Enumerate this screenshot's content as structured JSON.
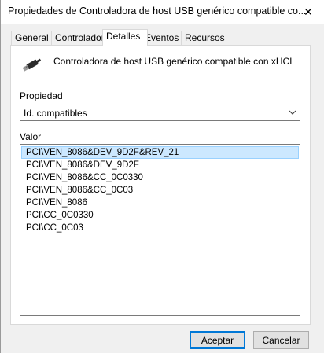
{
  "window": {
    "title": "Propiedades de Controladora de host USB genérico compatible co...",
    "close_glyph": "✕"
  },
  "tabs": [
    {
      "label": "General",
      "active": false
    },
    {
      "label": "Controlador",
      "active": false
    },
    {
      "label": "Detalles",
      "active": true
    },
    {
      "label": "Eventos",
      "active": false
    },
    {
      "label": "Recursos",
      "active": false
    }
  ],
  "device": {
    "icon": "usb-connector-icon",
    "name": "Controladora de host USB genérico compatible con xHCI"
  },
  "property": {
    "label": "Propiedad",
    "selected": "Id. compatibles"
  },
  "value": {
    "label": "Valor",
    "items": [
      "PCI\\VEN_8086&DEV_9D2F&REV_21",
      "PCI\\VEN_8086&DEV_9D2F",
      "PCI\\VEN_8086&CC_0C0330",
      "PCI\\VEN_8086&CC_0C03",
      "PCI\\VEN_8086",
      "PCI\\CC_0C0330",
      "PCI\\CC_0C03"
    ],
    "selected_index": 0
  },
  "buttons": {
    "accept": "Aceptar",
    "cancel": "Cancelar"
  },
  "colors": {
    "selection_bg": "#cce8ff",
    "selection_border": "#99d1ff",
    "default_button_border": "#0078d7"
  }
}
